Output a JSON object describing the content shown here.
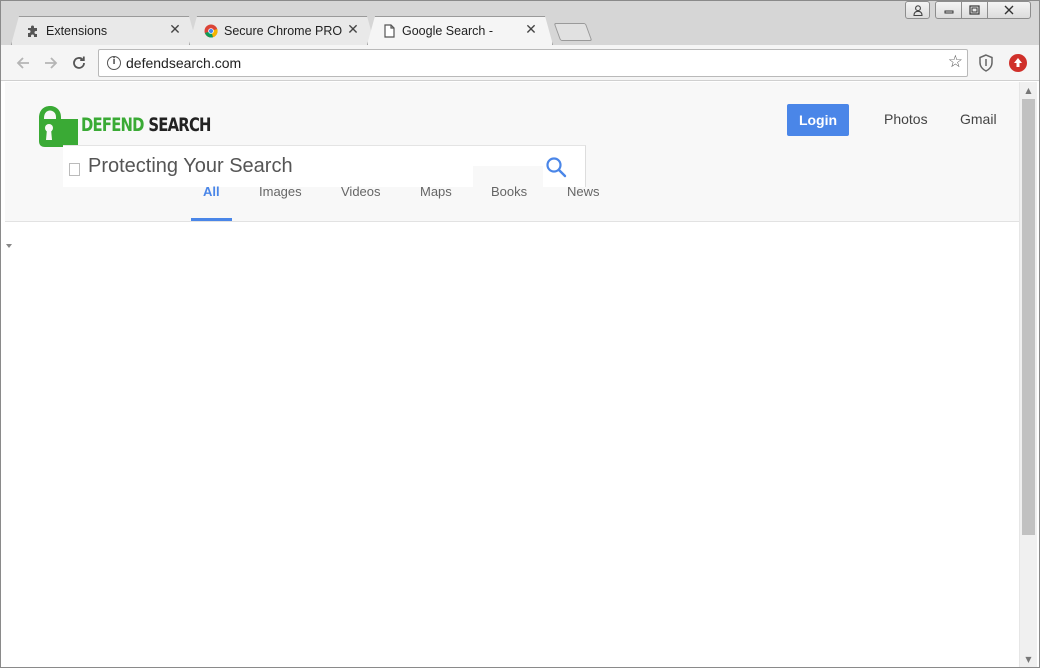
{
  "browser": {
    "tabs": [
      {
        "title": "Extensions",
        "icon": "puzzle-icon",
        "active": false
      },
      {
        "title": "Secure Chrome PRO -",
        "icon": "chrome-icon",
        "active": false
      },
      {
        "title": "Google Search -",
        "icon": "page-icon",
        "active": true
      }
    ],
    "address": "defendsearch.com",
    "window_controls": [
      "user-icon",
      "minimize-icon",
      "maximize-icon",
      "close-icon"
    ]
  },
  "page": {
    "logo": {
      "word1": "DEFEND",
      "word2": "SEARCH"
    },
    "login_label": "Login",
    "links": [
      "Photos",
      "Gmail"
    ],
    "search_placeholder": "Protecting Your Search",
    "nav": [
      "All",
      "Images",
      "Videos",
      "Maps",
      "Books",
      "News"
    ],
    "active_nav": "All"
  },
  "colors": {
    "accent": "#4a86e8",
    "logo_green": "#3aaa35",
    "extension_red": "#d0302a"
  }
}
